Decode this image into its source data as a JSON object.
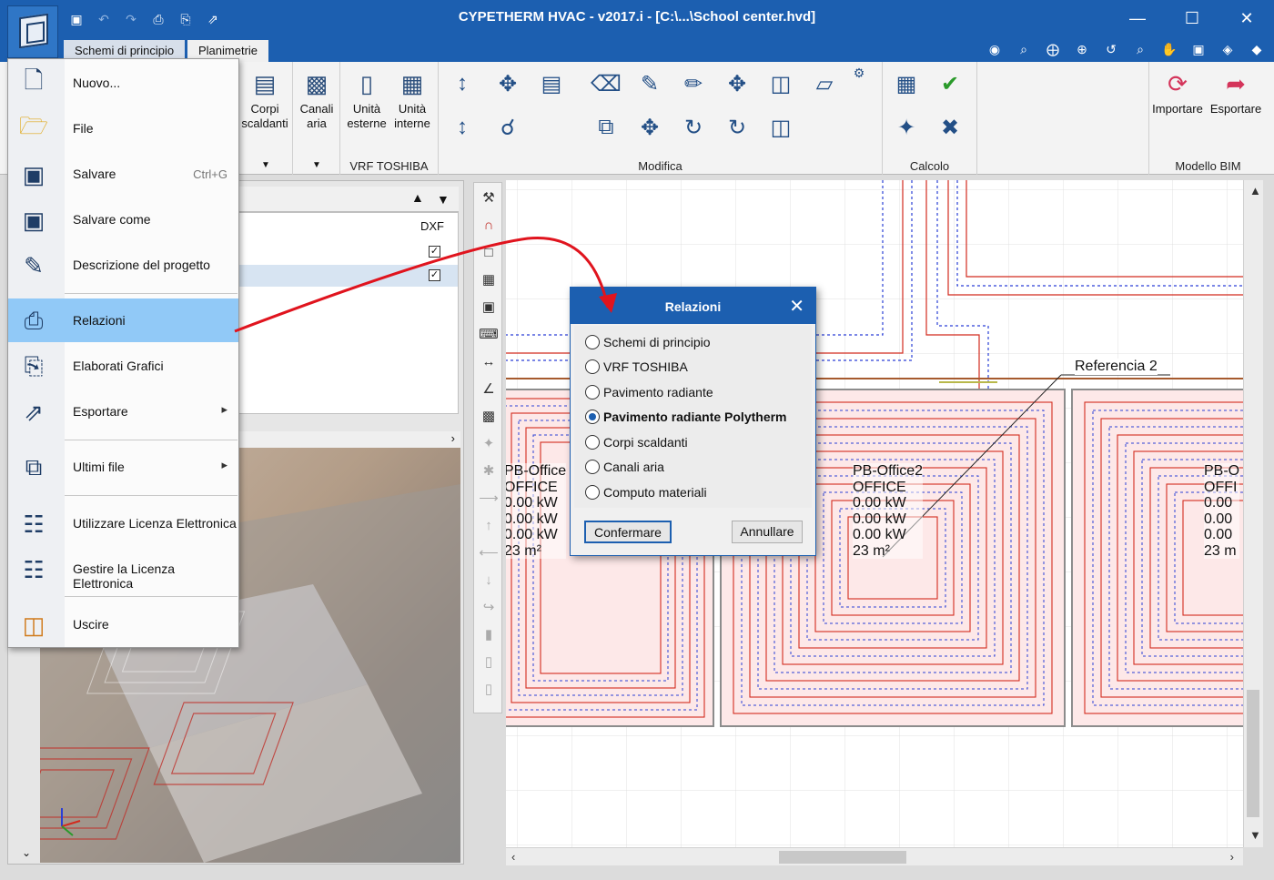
{
  "window": {
    "title": "CYPETHERM HVAC - v2017.i - [C:\\...\\School center.hvd]",
    "controls": [
      "minimize-icon",
      "maximize-icon",
      "close-icon"
    ]
  },
  "quick_access": [
    "save-icon",
    "undo-icon",
    "redo-icon",
    "print-icon",
    "print-preview-icon",
    "export-icon"
  ],
  "tabs": [
    {
      "label": "Schemi di principio"
    },
    {
      "label": "Planimetrie"
    }
  ],
  "ribbon": {
    "buttons": {
      "corpi_scaldanti": "Corpi\nscaldanti",
      "canali_aria": "Canali\naria",
      "unita_esterne": "Unità\nesterne",
      "unita_interne": "Unità\ninterne",
      "importare": "Importare",
      "esportare": "Esportare"
    },
    "groups": {
      "vrf": "VRF TOSHIBA",
      "modifica": "Modifica",
      "calcolo": "Calcolo",
      "bim": "Modello BIM"
    }
  },
  "app_menu": {
    "items": [
      {
        "label": "Nuovo...",
        "icon": "new-file-icon"
      },
      {
        "label": "File",
        "icon": "open-folder-icon"
      },
      {
        "label": "Salvare",
        "icon": "save-icon",
        "shortcut": "Ctrl+G"
      },
      {
        "label": "Salvare come",
        "icon": "save-as-icon"
      },
      {
        "label": "Descrizione del progetto",
        "icon": "project-description-icon"
      },
      {
        "label": "Relazioni",
        "icon": "reports-printer-icon"
      },
      {
        "label": "Elaborati Grafici",
        "icon": "plotter-icon"
      },
      {
        "label": "Esportare",
        "icon": "export-icon"
      },
      {
        "label": "Ultimi file",
        "icon": "recent-files-icon"
      },
      {
        "label": "Utilizzare Licenza Elettronica",
        "icon": "license-network-icon"
      },
      {
        "label": "Gestire la Licenza Elettronica",
        "icon": "manage-license-icon"
      },
      {
        "label": "Uscire",
        "icon": "exit-door-icon"
      }
    ]
  },
  "layers_panel": {
    "column": "DXF"
  },
  "dialog": {
    "title": "Relazioni",
    "options": [
      "Schemi di principio",
      "VRF TOSHIBA",
      "Pavimento radiante",
      "Pavimento radiante Polytherm",
      "Corpi scaldanti",
      "Canali aria",
      "Computo materiali"
    ],
    "selected_index": 3,
    "confirm": "Confermare",
    "cancel": "Annullare"
  },
  "drawing": {
    "reference_label": "Referencia 2",
    "rooms": [
      {
        "name": "PB-Office",
        "type": "OFFICE",
        "values": [
          "0.00 kW",
          "0.00 kW",
          "0.00 kW"
        ],
        "area": "23 m²"
      },
      {
        "name": "PB-Office2",
        "type": "OFFICE",
        "values": [
          "0.00 kW",
          "0.00 kW",
          "0.00 kW"
        ],
        "area": "23 m²"
      },
      {
        "name": "PB-O",
        "type": "OFFI",
        "values": [
          "0.00",
          "0.00",
          "0.00"
        ],
        "area": "23 m"
      }
    ]
  },
  "colors": {
    "titlebar": "#1c5fb0",
    "menu_highlight": "#91c9f7",
    "annotation_arrow": "#e0141e",
    "pipe_red": "#d22b1e",
    "pipe_blue": "#2a3fd6"
  }
}
